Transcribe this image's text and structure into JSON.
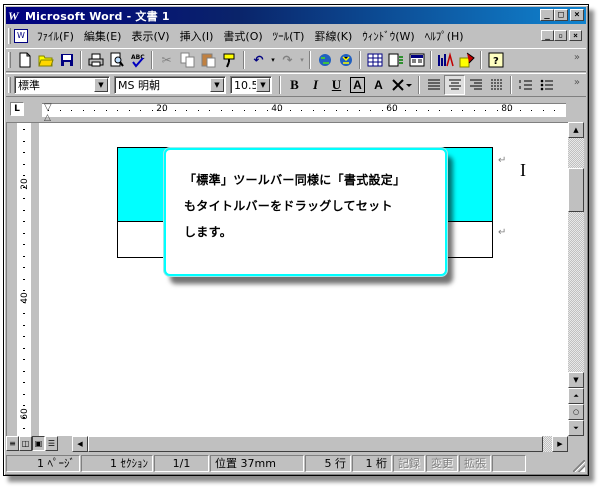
{
  "window": {
    "title": "Microsoft Word - 文書 1",
    "app_icon": "W"
  },
  "menubar": {
    "items": [
      "ﾌｧｲﾙ(F)",
      "編集(E)",
      "表示(V)",
      "挿入(I)",
      "書式(O)",
      "ﾂｰﾙ(T)",
      "罫線(K)",
      "ｳｨﾝﾄﾞｳ(W)",
      "ﾍﾙﾌﾟ(H)"
    ]
  },
  "standard_toolbar": {
    "icons": [
      "new-document-icon",
      "open-folder-icon",
      "save-icon",
      "print-icon",
      "print-preview-icon",
      "spellcheck-icon",
      "cut-icon",
      "copy-icon",
      "paste-icon",
      "format-painter-icon",
      "undo-icon",
      "redo-icon",
      "hyperlink-icon",
      "web-toolbar-icon",
      "table-insert-icon",
      "excel-insert-icon",
      "columns-icon",
      "drawing-icon",
      "document-map-icon",
      "help-icon"
    ]
  },
  "format_toolbar": {
    "style": "標準",
    "font": "MS 明朝",
    "size": "10.5",
    "bold": "B",
    "italic": "I",
    "underline": "U",
    "char_border": "A",
    "char_shading": "A",
    "active_alignment": "center"
  },
  "ruler": {
    "numbers": [
      "20",
      "40",
      "60",
      "80"
    ],
    "vertical_numbers": [
      "20",
      "40",
      "60"
    ]
  },
  "callout": {
    "line1": "「標準」ツールバー同様に「書式設定」",
    "line2": "もタイトルバーをドラッグしてセット",
    "line3": "します。"
  },
  "colors": {
    "titlebar_start": "#000080",
    "titlebar_end": "#1084d0",
    "table_fill": "#00ffff",
    "callout_border": "#00ffff",
    "chrome": "#c0c0c0"
  },
  "statusbar": {
    "page": "1 ﾍﾟｰｼﾞ",
    "section": "1 ｾｸｼｮﾝ",
    "page_of": "1/1",
    "position": "位置 37mm",
    "line": "5 行",
    "column": "1 桁",
    "rec": "記録",
    "trk": "変更",
    "ext": "拡張"
  }
}
